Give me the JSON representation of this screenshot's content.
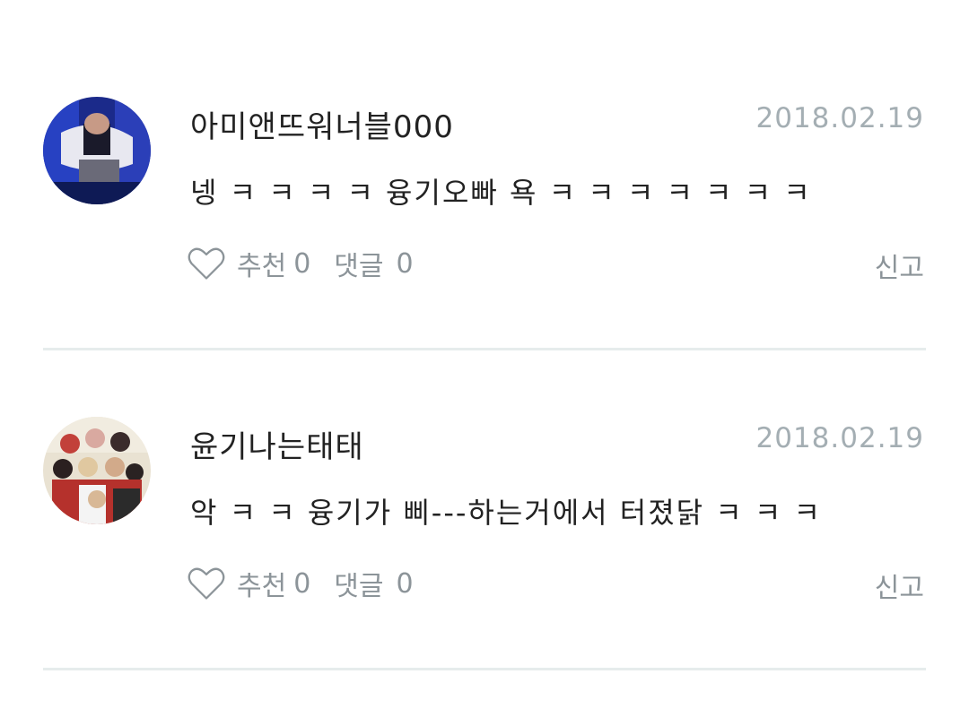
{
  "comments": [
    {
      "username": "아미앤뜨워너블000",
      "date": "2018.02.19",
      "text": "넹 ㅋ ㅋ ㅋ ㅋ 융기오빠 욕 ㅋ ㅋ ㅋ ㅋ ㅋ ㅋ ㅋ",
      "like_label": "추천",
      "like_count": "0",
      "reply_label": "댓글",
      "reply_count": "0",
      "report_label": "신고"
    },
    {
      "username": "윤기나는태태",
      "date": "2018.02.19",
      "text": "악 ㅋ ㅋ 융기가 삐---하는거에서 터졌닭 ㅋ ㅋ ㅋ",
      "like_label": "추천",
      "like_count": "0",
      "reply_label": "댓글",
      "reply_count": "0",
      "report_label": "신고"
    }
  ],
  "colors": {
    "text": "#222222",
    "muted": "#8c9499",
    "date": "#a4aeb3",
    "divider": "#e6ecec"
  },
  "icons": {
    "like": "heart-outline-icon"
  }
}
